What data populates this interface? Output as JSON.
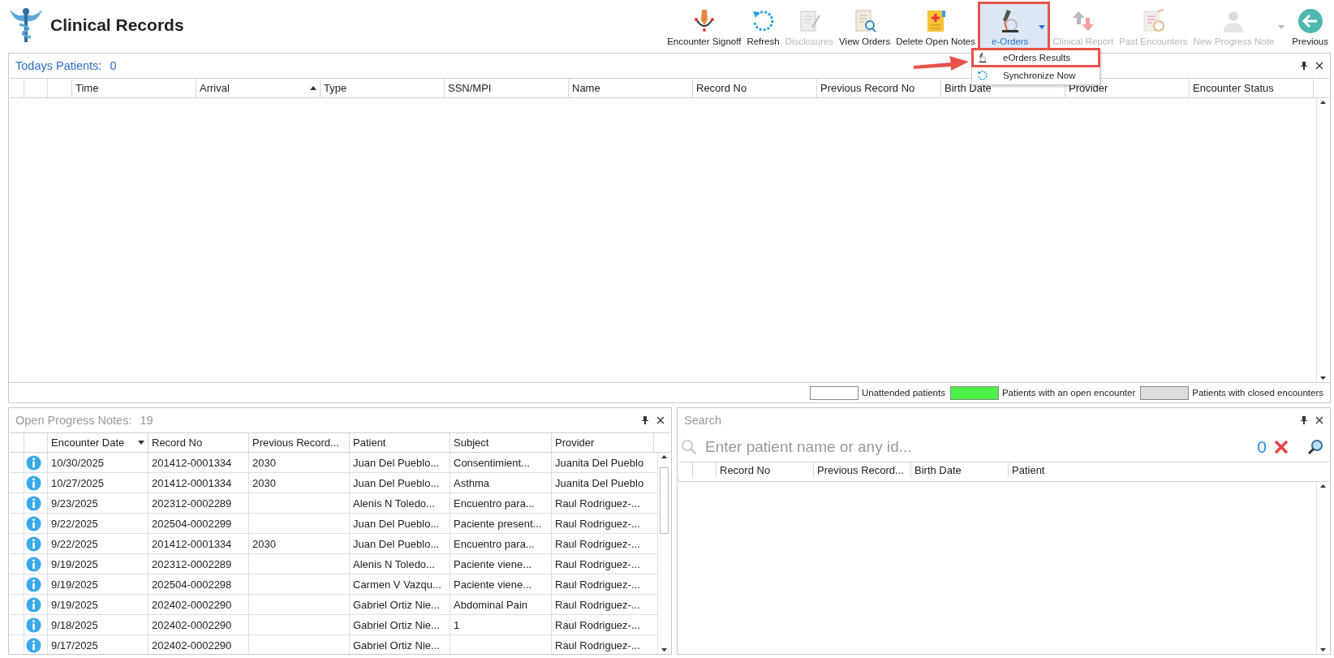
{
  "app": {
    "title": "Clinical Records"
  },
  "toolbar": [
    {
      "label": "Encounter Signoff",
      "kind": "signoff",
      "disabled": false,
      "selected": false,
      "dropdown": false
    },
    {
      "label": "Refresh",
      "kind": "refresh",
      "disabled": false,
      "selected": false,
      "dropdown": false
    },
    {
      "label": "Disclosures",
      "kind": "document",
      "disabled": true,
      "selected": false,
      "dropdown": false
    },
    {
      "label": "View Orders",
      "kind": "view",
      "disabled": false,
      "selected": false,
      "dropdown": false
    },
    {
      "label": "Delete Open Notes",
      "kind": "notes",
      "disabled": false,
      "selected": false,
      "dropdown": false
    },
    {
      "label": "e-Orders",
      "kind": "microscope",
      "disabled": false,
      "selected": true,
      "dropdown": true
    },
    {
      "label": "Clinical Report",
      "kind": "report",
      "disabled": true,
      "selected": false,
      "dropdown": false
    },
    {
      "label": "Past Encounters",
      "kind": "clipboard",
      "disabled": true,
      "selected": false,
      "dropdown": false
    },
    {
      "label": "New Progress Note",
      "kind": "person",
      "disabled": true,
      "selected": false,
      "dropdown": true
    },
    {
      "label": "Previous",
      "kind": "back",
      "disabled": false,
      "selected": false,
      "dropdown": false
    }
  ],
  "eorders_menu": [
    {
      "label": "eOrders Results",
      "kind": "microscope",
      "selected": true
    },
    {
      "label": "Synchronize Now",
      "kind": "sync",
      "selected": false
    }
  ],
  "todays_patients": {
    "title": "Todays Patients:",
    "count": "0",
    "active": true,
    "columns": [
      {
        "label": "Time",
        "sort_ascending": false,
        "sort_descending": false
      },
      {
        "label": "Arrival",
        "sort_ascending": true,
        "sort_descending": false
      },
      {
        "label": "Type",
        "sort_ascending": false,
        "sort_descending": false
      },
      {
        "label": "SSN/MPI",
        "sort_ascending": false,
        "sort_descending": false
      },
      {
        "label": "Name",
        "sort_ascending": false,
        "sort_descending": false
      },
      {
        "label": "Record No",
        "sort_ascending": false,
        "sort_descending": false
      },
      {
        "label": "Previous Record No",
        "sort_ascending": false,
        "sort_descending": false
      },
      {
        "label": "Birth Date",
        "sort_ascending": false,
        "sort_descending": false
      },
      {
        "label": "Provider",
        "sort_ascending": false,
        "sort_descending": false
      },
      {
        "label": "Encounter Status",
        "sort_ascending": false,
        "sort_descending": false
      }
    ],
    "legend": [
      {
        "label": "Unattended patients",
        "color": "#ffffff"
      },
      {
        "label": "Patients with an open encounter",
        "color": "#4cf046"
      },
      {
        "label": "Patients with closed encounters",
        "color": "#dcdcdc"
      }
    ]
  },
  "open_progress_notes": {
    "title": "Open Progress Notes:",
    "count": "19",
    "active": false,
    "columns": [
      {
        "label": "Encounter Date",
        "sort_ascending": false,
        "sort_descending": true
      },
      {
        "label": "Record No",
        "sort_ascending": false,
        "sort_descending": false
      },
      {
        "label": "Previous Record...",
        "sort_ascending": false,
        "sort_descending": false
      },
      {
        "label": "Patient",
        "sort_ascending": false,
        "sort_descending": false
      },
      {
        "label": "Subject",
        "sort_ascending": false,
        "sort_descending": false
      },
      {
        "label": "Provider",
        "sort_ascending": false,
        "sort_descending": false
      }
    ],
    "rows": [
      {
        "encounter_date": "10/30/2025",
        "record_no": "201412-0001334",
        "previous_record_no": "2030",
        "patient": "Juan Del Pueblo...",
        "subject": "Consentimient...",
        "provider": "Juanita Del Pueblo"
      },
      {
        "encounter_date": "10/27/2025",
        "record_no": "201412-0001334",
        "previous_record_no": "2030",
        "patient": "Juan Del Pueblo...",
        "subject": "Asthma",
        "provider": "Juanita Del Pueblo"
      },
      {
        "encounter_date": "9/23/2025",
        "record_no": "202312-0002289",
        "patient": "Alenis N Toledo...",
        "subject": "Encuentro para...",
        "provider": "Raul Rodriguez-..."
      },
      {
        "encounter_date": "9/22/2025",
        "record_no": "202504-0002299",
        "patient": "Juan Del Pueblo...",
        "subject": "Paciente present...",
        "provider": "Raul Rodriguez-..."
      },
      {
        "encounter_date": "9/22/2025",
        "record_no": "201412-0001334",
        "previous_record_no": "2030",
        "patient": "Juan Del Pueblo...",
        "subject": "Encuentro para...",
        "provider": "Raul Rodriguez-..."
      },
      {
        "encounter_date": "9/19/2025",
        "record_no": "202312-0002289",
        "patient": "Alenis N Toledo...",
        "subject": "Paciente viene...",
        "provider": "Raul Rodriguez-..."
      },
      {
        "encounter_date": "9/19/2025",
        "record_no": "202504-0002298",
        "patient": "Carmen V Vazqu...",
        "subject": "Paciente viene...",
        "provider": "Raul Rodriguez-..."
      },
      {
        "encounter_date": "9/19/2025",
        "record_no": "202402-0002290",
        "patient": "Gabriel Ortiz Nie...",
        "subject": "Abdominal Pain",
        "provider": "Raul Rodriguez-..."
      },
      {
        "encounter_date": "9/18/2025",
        "record_no": "202402-0002290",
        "patient": "Gabriel Ortiz Nie...",
        "subject": "1",
        "provider": "Raul Rodriguez-..."
      },
      {
        "encounter_date": "9/17/2025",
        "record_no": "202402-0002290",
        "patient": "Gabriel Ortiz Nie...",
        "provider": "Raul Rodriguez-..."
      }
    ]
  },
  "search": {
    "title": "Search",
    "active": false,
    "placeholder": "Enter patient name or any id...",
    "count": "0",
    "columns": [
      {
        "label": "Record No",
        "sort_ascending": false,
        "sort_descending": false
      },
      {
        "label": "Previous Record...",
        "sort_ascending": false,
        "sort_descending": false
      },
      {
        "label": "Birth Date",
        "sort_ascending": false,
        "sort_descending": false
      },
      {
        "label": "Patient",
        "sort_ascending": false,
        "sort_descending": false
      }
    ]
  }
}
